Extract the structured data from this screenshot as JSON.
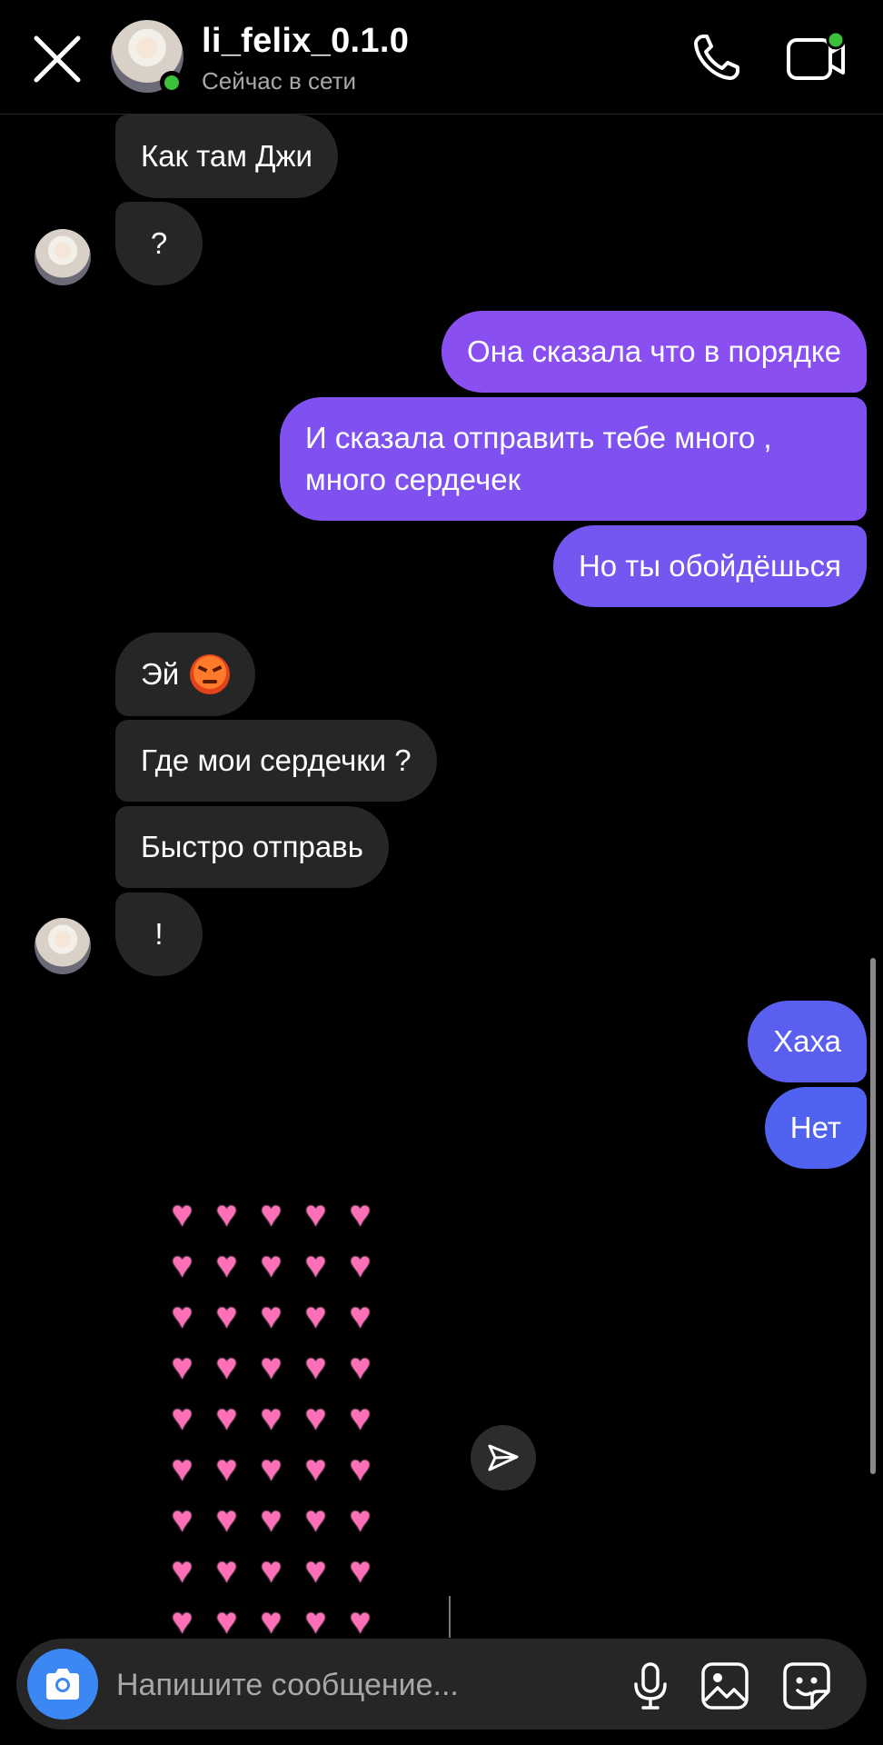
{
  "header": {
    "username": "li_felix_0.1.0",
    "status": "Сейчас в сети",
    "icons": [
      "close-icon",
      "phone-icon",
      "video-camera-icon"
    ]
  },
  "messages": [
    {
      "from": "them",
      "text": "Как там Джи"
    },
    {
      "from": "them",
      "text": "?"
    },
    {
      "from": "me",
      "text": "Она сказала что в порядке"
    },
    {
      "from": "me",
      "text": "И сказала отправить тебе много , много сердечек"
    },
    {
      "from": "me",
      "text": "Но ты обойдёшься"
    },
    {
      "from": "them",
      "text": "Эй",
      "emoji": "angry-face-emoji"
    },
    {
      "from": "them",
      "text": "Где мои сердечки ?"
    },
    {
      "from": "them",
      "text": "Быстро отправь"
    },
    {
      "from": "them",
      "text": "!"
    },
    {
      "from": "me",
      "text": "Хаха"
    },
    {
      "from": "me",
      "text": "Нет"
    }
  ],
  "draft": {
    "content": "many pink heart emojis (9 rows × 5)"
  },
  "composer": {
    "placeholder": "Напишите сообщение..."
  },
  "colors": {
    "outgoing_gradient_top": "#8a4ff0",
    "outgoing_gradient_bottom": "#5a5ff0",
    "incoming": "#262626",
    "online": "#3ec13a",
    "camera_button": "#3b88f5"
  }
}
